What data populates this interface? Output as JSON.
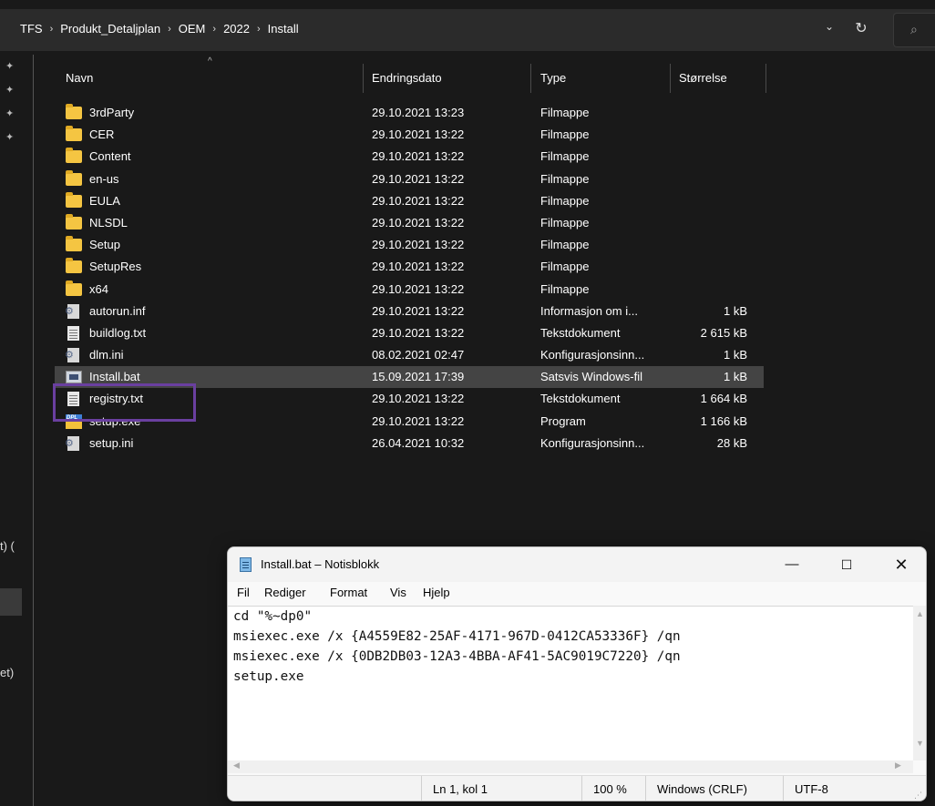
{
  "breadcrumb": [
    "TFS",
    "Produkt_Detaljplan",
    "OEM",
    "2022",
    "Install"
  ],
  "address_icons": {
    "dropdown": "chevron-down-icon",
    "refresh": "refresh-icon",
    "search": "search-icon"
  },
  "nav": {
    "partial_labels": [
      "t) (",
      "et)"
    ]
  },
  "columns": {
    "name": "Navn",
    "date": "Endringsdato",
    "type": "Type",
    "size": "Størrelse"
  },
  "files": [
    {
      "name": "3rdParty",
      "date": "29.10.2021 13:23",
      "type": "Filmappe",
      "size": "",
      "icon": "folder-icon"
    },
    {
      "name": "CER",
      "date": "29.10.2021 13:22",
      "type": "Filmappe",
      "size": "",
      "icon": "folder-icon"
    },
    {
      "name": "Content",
      "date": "29.10.2021 13:22",
      "type": "Filmappe",
      "size": "",
      "icon": "folder-icon"
    },
    {
      "name": "en-us",
      "date": "29.10.2021 13:22",
      "type": "Filmappe",
      "size": "",
      "icon": "folder-icon"
    },
    {
      "name": "EULA",
      "date": "29.10.2021 13:22",
      "type": "Filmappe",
      "size": "",
      "icon": "folder-icon"
    },
    {
      "name": "NLSDL",
      "date": "29.10.2021 13:22",
      "type": "Filmappe",
      "size": "",
      "icon": "folder-icon"
    },
    {
      "name": "Setup",
      "date": "29.10.2021 13:22",
      "type": "Filmappe",
      "size": "",
      "icon": "folder-icon"
    },
    {
      "name": "SetupRes",
      "date": "29.10.2021 13:22",
      "type": "Filmappe",
      "size": "",
      "icon": "folder-icon"
    },
    {
      "name": "x64",
      "date": "29.10.2021 13:22",
      "type": "Filmappe",
      "size": "",
      "icon": "folder-icon"
    },
    {
      "name": "autorun.inf",
      "date": "29.10.2021 13:22",
      "type": "Informasjon om i...",
      "size": "1 kB",
      "icon": "gear-doc-icon"
    },
    {
      "name": "buildlog.txt",
      "date": "29.10.2021 13:22",
      "type": "Tekstdokument",
      "size": "2 615 kB",
      "icon": "doc-icon"
    },
    {
      "name": "dlm.ini",
      "date": "08.02.2021 02:47",
      "type": "Konfigurasjonsinn...",
      "size": "1 kB",
      "icon": "gear-doc-icon"
    },
    {
      "name": "Install.bat",
      "date": "15.09.2021 17:39",
      "type": "Satsvis Windows-fil",
      "size": "1 kB",
      "icon": "bat-icon",
      "selected": true
    },
    {
      "name": "registry.txt",
      "date": "29.10.2021 13:22",
      "type": "Tekstdokument",
      "size": "1 664 kB",
      "icon": "doc-icon"
    },
    {
      "name": "setup.exe",
      "date": "29.10.2021 13:22",
      "type": "Program",
      "size": "1 166 kB",
      "icon": "exe-icon"
    },
    {
      "name": "setup.ini",
      "date": "26.04.2021 10:32",
      "type": "Konfigurasjonsinn...",
      "size": "28 kB",
      "icon": "gear-doc-icon"
    }
  ],
  "notepad": {
    "title": "Install.bat – Notisblokk",
    "menu": [
      "Fil",
      "Rediger",
      "Format",
      "Vis",
      "Hjelp"
    ],
    "lines": [
      "cd \"%~dp0\"",
      "msiexec.exe /x {A4559E82-25AF-4171-967D-0412CA53336F} /qn",
      "msiexec.exe /x {0DB2DB03-12A3-4BBA-AF41-5AC9019C7220} /qn",
      "setup.exe"
    ],
    "status": {
      "position": "Ln 1, kol 1",
      "zoom": "100 %",
      "line_ending": "Windows (CRLF)",
      "encoding": "UTF-8"
    },
    "controls": {
      "minimize": "—",
      "maximize": "☐",
      "close": "✕"
    }
  },
  "colors": {
    "explorer_bg": "#191919",
    "highlight_border": "#6a3fa0",
    "selected_row": "#444444",
    "folder": "#f5c542"
  }
}
